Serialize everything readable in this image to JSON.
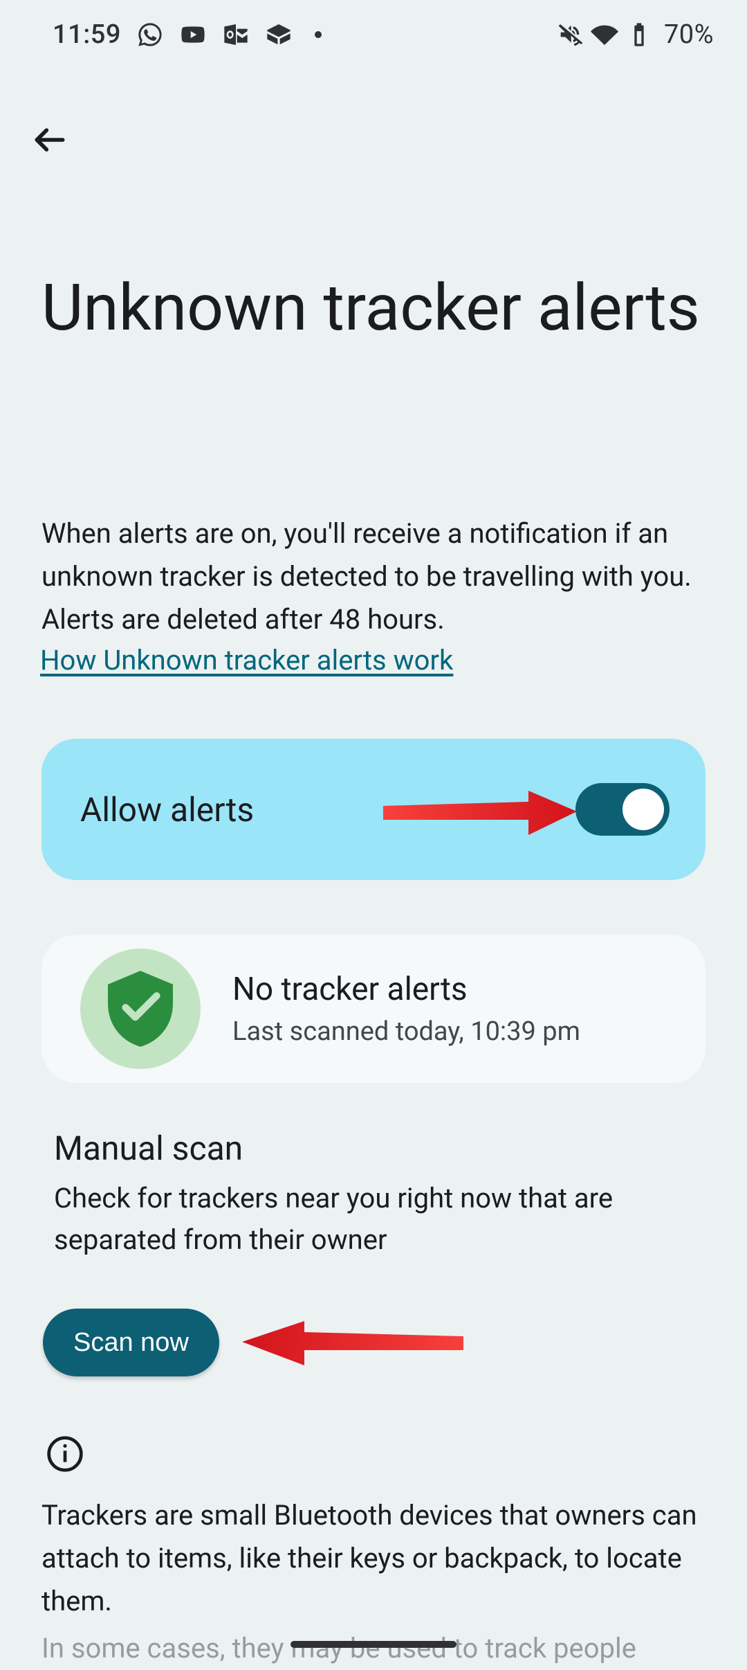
{
  "status_bar": {
    "time": "11:59",
    "battery": "70%"
  },
  "header": {
    "title": "Unknown tracker alerts",
    "description": "When alerts are on, you'll receive a notification if an unknown tracker is detected to be travelling with you. Alerts are deleted after 48 hours.",
    "link_text": "How Unknown tracker alerts work"
  },
  "allow_alerts": {
    "label": "Allow alerts",
    "enabled": true
  },
  "status_card": {
    "title": "No tracker alerts",
    "subtitle": "Last scanned today, 10:39 pm"
  },
  "manual_scan": {
    "title": "Manual scan",
    "description": "Check for trackers near you right now that are separated from their owner",
    "button": "Scan now"
  },
  "info": {
    "paragraph1": "Trackers are small Bluetooth devices that owners can attach to items, like their keys or backpack, to locate them.",
    "paragraph2_partial": "In some cases, they may be used to track people"
  },
  "annotations": {
    "arrow_color": "#ed2a2e"
  }
}
